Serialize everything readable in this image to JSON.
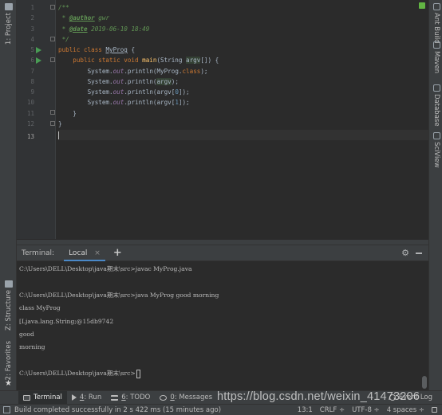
{
  "left_toolbar": {
    "project": "1: Project",
    "structure": "Z: Structure",
    "favorites": "2: Favorites"
  },
  "right_toolbar": {
    "ant": "Ant Build",
    "maven": "Maven",
    "database": "Database",
    "sciview": "SciView"
  },
  "editor": {
    "line_numbers": [
      "1",
      "2",
      "3",
      "4",
      "5",
      "6",
      "7",
      "8",
      "9",
      "10",
      "11",
      "12",
      "13"
    ],
    "line1": "/**",
    "line2_prefix": " * ",
    "line2_tag": "@author",
    "line2_val": " gwr",
    "line3_prefix": " * ",
    "line3_tag": "@date",
    "line3_val": " 2019-06-10 18:49",
    "line4": " */",
    "line5_kw": "public class ",
    "line5_name": "MyProg",
    "line5_end": " {",
    "line6_kw": "    public static void ",
    "line6_fn": "main",
    "line6_open": "(String ",
    "line6_param": "argv",
    "line6_end": "[]) {",
    "sys": "System.",
    "out": "out",
    "println": ".println(",
    "line7_arg": "MyProg.",
    "line7_kw": "class",
    "line7_end": ");",
    "line8_arg": "argv",
    "line8_end": ");",
    "line9_arg": "argv[",
    "line9_num": "0",
    "line9_end": "]);",
    "line10_arg": "argv[",
    "line10_num": "1",
    "line10_end": "]);",
    "line11": "    }",
    "line12": "}"
  },
  "terminal": {
    "title": "Terminal:",
    "tab": "Local",
    "close": "×",
    "add": "+",
    "gear": "⚙",
    "lines": [
      "C:\\Users\\DELL\\Desktop\\java期末\\src>javac MyProg.java",
      "",
      "C:\\Users\\DELL\\Desktop\\java期末\\src>java MyProg good morning",
      "class MyProg",
      "[Ljava.lang.String;@15db9742",
      "good",
      "morning",
      "",
      "C:\\Users\\DELL\\Desktop\\java期末\\src>"
    ]
  },
  "tool_windows": {
    "terminal": "Terminal",
    "run_num": "4",
    "run": ": Run",
    "todo_num": "6",
    "todo": ": TODO",
    "messages_num": "0",
    "messages": ": Messages",
    "event_log": "Event Log"
  },
  "status": {
    "message": "Build completed successfully in 2 s 422 ms (15 minutes ago)",
    "position": "13:1",
    "line_sep": "CRLF ÷",
    "encoding": "UTF-8 ÷",
    "indent": "4 spaces ÷"
  },
  "watermark": "https://blog.csdn.net/weixin_41473206"
}
